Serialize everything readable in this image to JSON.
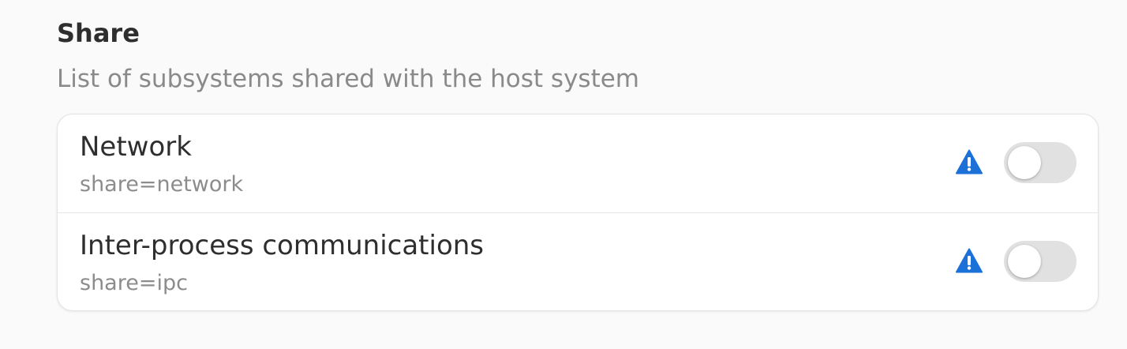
{
  "section": {
    "title": "Share",
    "subtitle": "List of subsystems shared with the host system"
  },
  "rows": [
    {
      "title": "Network",
      "subtitle": "share=network",
      "icon": "warning-icon",
      "toggle_on": false
    },
    {
      "title": "Inter-process communications",
      "subtitle": "share=ipc",
      "icon": "warning-icon",
      "toggle_on": false
    }
  ],
  "colors": {
    "warning": "#1c71d8",
    "toggle_off": "#e1e1e1",
    "background": "#fafafa"
  }
}
